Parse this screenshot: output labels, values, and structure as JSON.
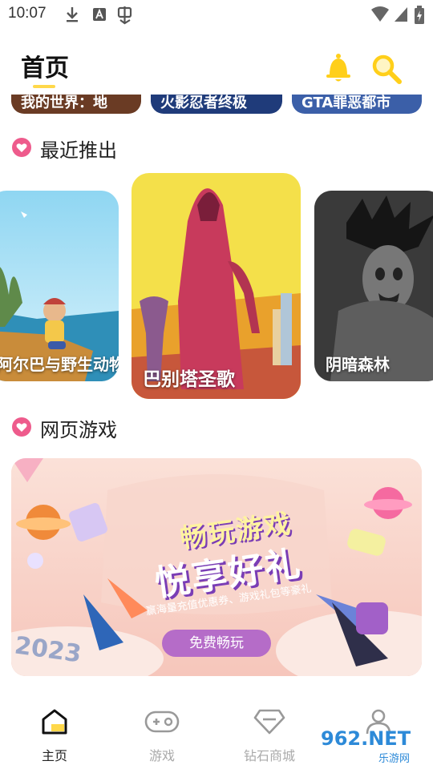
{
  "status_bar": {
    "time": "10:07",
    "left_icons": [
      "download-icon",
      "a-badge-icon",
      "app-icon"
    ],
    "right_icons": [
      "wifi-icon",
      "signal-icon",
      "battery-icon"
    ]
  },
  "header": {
    "title": "首页",
    "icons": [
      "bell-icon",
      "search-icon"
    ],
    "accent_color": "#ffd84a"
  },
  "top_strip": {
    "cards": [
      {
        "label": "我的世界：地"
      },
      {
        "label": "火影忍者终极"
      },
      {
        "label": "GTA罪恶都市"
      }
    ]
  },
  "recent_section": {
    "title": "最近推出",
    "heart_color": "#ee5b8c",
    "cards": [
      {
        "label": "阿尔巴与野生动物"
      },
      {
        "label": "巴别塔圣歌"
      },
      {
        "label": "阴暗森林"
      }
    ]
  },
  "web_game_section": {
    "title": "网页游戏",
    "banner": {
      "headline": "畅玩游戏",
      "slogan": "悦享好礼",
      "subtitle": "赢海量充值优惠券、游戏礼包等豪礼",
      "button": "免费畅玩",
      "year": "2023"
    }
  },
  "bottom_nav": {
    "items": [
      {
        "label": "主页",
        "icon": "home-icon",
        "active": true
      },
      {
        "label": "游戏",
        "icon": "gamepad-icon",
        "active": false
      },
      {
        "label": "钻石商城",
        "icon": "diamond-icon",
        "active": false
      },
      {
        "label": "",
        "icon": "profile-icon",
        "active": false
      }
    ]
  },
  "watermark": {
    "text": "962.NET",
    "subtext": "乐游网"
  }
}
